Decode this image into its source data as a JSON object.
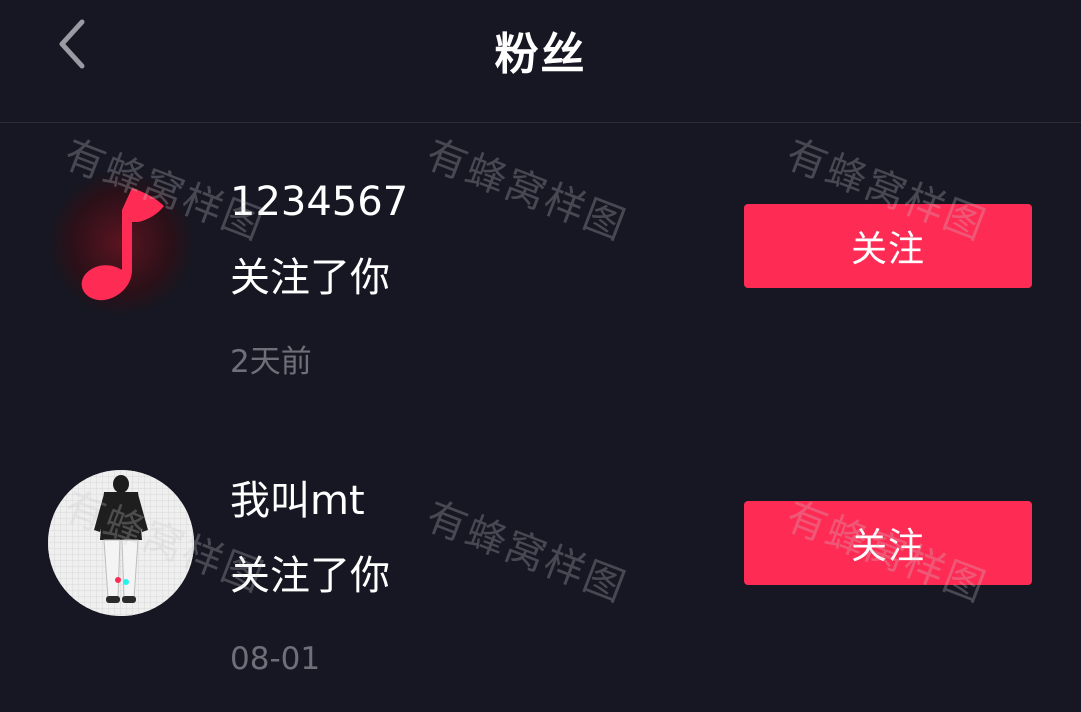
{
  "header": {
    "title": "粉丝",
    "back_icon": "chevron-left-icon"
  },
  "followers": [
    {
      "name": "1234567",
      "action": "关注了你",
      "time": "2天前",
      "button_label": "关注",
      "avatar_icon": "music-note-icon"
    },
    {
      "name": "我叫mt",
      "action": "关注了你",
      "time": "08-01",
      "button_label": "关注",
      "avatar_icon": "person-photo-avatar"
    }
  ],
  "watermark": "有蜂窝样图",
  "colors": {
    "background": "#161722",
    "accent": "#fe2c55",
    "text_primary": "#ffffff",
    "text_secondary": "#6e6f78"
  }
}
